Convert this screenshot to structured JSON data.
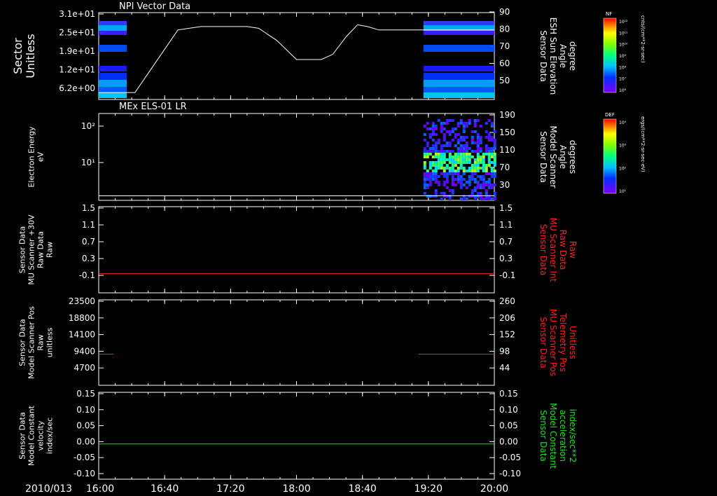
{
  "chart_data": {
    "type": "multi-panel-timeseries",
    "date_label": "2010/013",
    "time_axis": {
      "start_minutes": 960,
      "end_minutes": 1200,
      "tick_labels": [
        "16:00",
        "16:40",
        "17:20",
        "18:00",
        "18:40",
        "19:20",
        "20:00"
      ],
      "tick_minutes": [
        960,
        1000,
        1040,
        1080,
        1120,
        1160,
        1200
      ]
    },
    "panels": [
      {
        "id": "p1",
        "title": "NPI Vector Data",
        "kind": "spectrogram-sector",
        "left_label": [
          "Sector",
          "Unitless"
        ],
        "left_label_color": "#ffffff",
        "left_ticks": [
          "3.1e+01",
          "2.5e+01",
          "1.9e+01",
          "1.2e+01",
          "6.2e+00"
        ],
        "right_label": [
          "Sensor Data",
          "ESH Sun Elevation",
          "Angle",
          "degree"
        ],
        "right_label_color": "#ffffff",
        "right_ticks": [
          "90",
          "80",
          "70",
          "60",
          "50"
        ],
        "right_range": [
          40,
          90
        ],
        "line_color": "#ffffff",
        "line_x": [
          960,
          978,
          982,
          995,
          1008,
          1022,
          1050,
          1057,
          1068,
          1080,
          1095,
          1102,
          1110,
          1117,
          1123,
          1130,
          1150,
          1200
        ],
        "line_y": [
          44,
          44,
          44,
          62,
          80,
          82,
          82,
          81,
          74,
          63,
          63,
          66,
          76,
          83,
          82,
          80,
          80,
          80
        ],
        "data_intervals": [
          [
            960,
            977
          ],
          [
            1157,
            1200
          ]
        ],
        "colorbar": {
          "title": "NF",
          "label": "cnts/(cm**2-sr-sec)",
          "ticks": [
            "10¹²",
            "10¹¹",
            "10¹⁰",
            "10⁹",
            "10⁸",
            "10⁷",
            "10⁶"
          ]
        }
      },
      {
        "id": "p2",
        "title": "MEx ELS-01 LR",
        "kind": "spectrogram-energy",
        "left_label": [
          "Electron Energy",
          "eV"
        ],
        "left_label_color": "#ffffff",
        "left_ticks": [
          "10²",
          "10¹"
        ],
        "right_label": [
          "Sensor Data",
          "Model Scanner",
          "Angle",
          "degrees"
        ],
        "right_label_color": "#ffffff",
        "right_ticks": [
          "190",
          "150",
          "110",
          "70",
          "30"
        ],
        "right_range": [
          0,
          190
        ],
        "line_color": "#ffffff",
        "line_x": [
          960,
          1200
        ],
        "line_y": [
          10,
          10
        ],
        "data_intervals": [
          [
            1157,
            1200
          ]
        ],
        "colorbar": {
          "title": "DEF",
          "label": "ergs/(cm**2-sr-sec-eV)",
          "ticks": [
            "10⁴",
            "10³",
            "10²",
            "10¹"
          ]
        }
      },
      {
        "id": "p3",
        "title": "",
        "kind": "line",
        "left_label": [
          "Sensor Data",
          "MU Scanner +30V",
          "Raw Data",
          "Raw"
        ],
        "left_label_color": "#ffffff",
        "left_ticks": [
          "1.5",
          "1.1",
          "0.7",
          "0.3",
          "-0.1"
        ],
        "left_range": [
          -0.4,
          1.5
        ],
        "right_label": [
          "Sensor Data",
          "MU Scanner Int",
          "Raw Data",
          "Raw"
        ],
        "right_label_color": "#ff2020",
        "right_ticks": [
          "1.5",
          "1.1",
          "0.7",
          "0.3",
          "-0.1"
        ],
        "line_color": "#ff2020",
        "series": [
          {
            "x": [
              960,
              1200
            ],
            "y": [
              0.0,
              0.0
            ]
          }
        ]
      },
      {
        "id": "p4",
        "title": "",
        "kind": "line",
        "left_label": [
          "Sensor Data",
          "Model Scanner Pos",
          "Raw",
          "unitless"
        ],
        "left_label_color": "#ffffff",
        "left_ticks": [
          "23500",
          "18800",
          "14100",
          "9400",
          "4700"
        ],
        "left_range": [
          0,
          23500
        ],
        "right_label": [
          "Sensor Data",
          "MU Scanner Pos",
          "Telemetry Pos",
          "Unitless"
        ],
        "right_label_color": "#ff2020",
        "right_ticks": [
          "260",
          "206",
          "152",
          "98",
          "44"
        ],
        "line_color": "#ff2020",
        "series": [
          {
            "x": [
              960,
              969
            ],
            "y": [
              8400,
              8400
            ]
          },
          {
            "x": [
              1154,
              1200
            ],
            "y": [
              8400,
              8400
            ]
          }
        ]
      },
      {
        "id": "p5",
        "title": "",
        "kind": "line",
        "left_label": [
          "Sensor Data",
          "Model Constant",
          "velocity",
          "index/sec"
        ],
        "left_label_color": "#ffffff",
        "left_ticks": [
          "0.15",
          "0.10",
          "0.05",
          "0.00",
          "-0.05",
          "-0.10"
        ],
        "left_range": [
          -0.1,
          0.15
        ],
        "right_label": [
          "Sensor Data",
          "Model Constant",
          "acceleration",
          "index/sec**2"
        ],
        "right_label_color": "#20e020",
        "right_ticks": [
          "0.15",
          "0.10",
          "0.05",
          "0.00",
          "-0.05",
          "-0.10"
        ],
        "line_color": "#20e020",
        "series": [
          {
            "x": [
              960,
              1200
            ],
            "y": [
              0.0,
              0.0
            ]
          }
        ]
      }
    ]
  }
}
